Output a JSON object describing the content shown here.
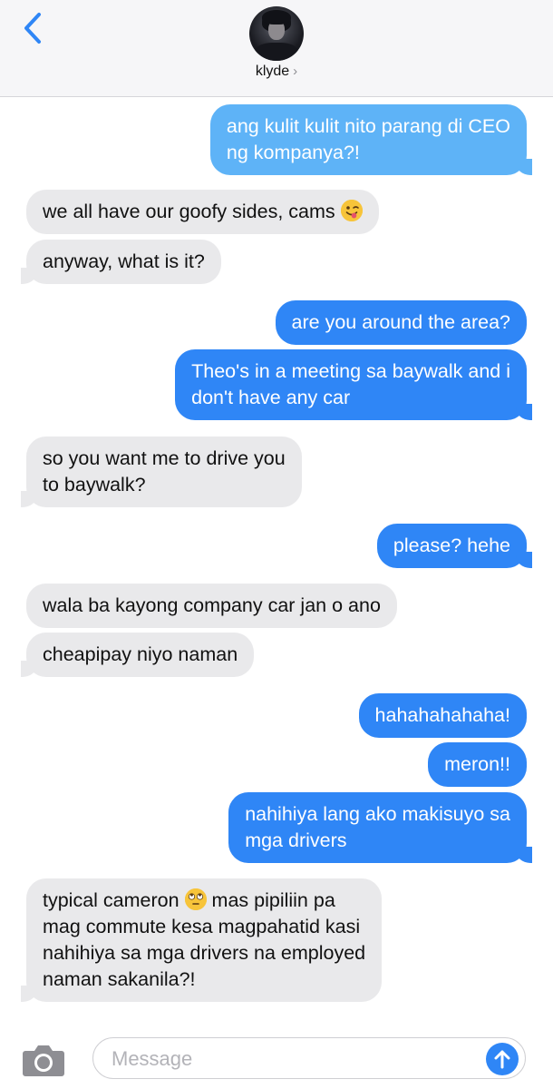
{
  "header": {
    "back_icon": "chevron-left-icon",
    "contact_name": "klyde",
    "contact_chevron": "›",
    "accent_color": "#2f86f6"
  },
  "messages": [
    {
      "sender": "me",
      "lines": [
        "ang kulit kulit nito parang di CEO",
        "ng kompanya?!"
      ]
    },
    {
      "sender": "them",
      "lines": [
        "we all have our goofy sides, cams"
      ],
      "emoji": "winking-face-with-tongue"
    },
    {
      "sender": "them",
      "lines": [
        "anyway, what is it?"
      ]
    },
    {
      "sender": "me",
      "lines": [
        "are you around the area?"
      ]
    },
    {
      "sender": "me",
      "lines": [
        "Theo's in a meeting sa baywalk and i",
        "don't have any car"
      ]
    },
    {
      "sender": "them",
      "lines": [
        "so you want me to drive you",
        "to baywalk?"
      ]
    },
    {
      "sender": "me",
      "lines": [
        "please? hehe"
      ]
    },
    {
      "sender": "them",
      "lines": [
        "wala ba kayong company car jan o ano"
      ]
    },
    {
      "sender": "them",
      "lines": [
        "cheapipay niyo naman"
      ]
    },
    {
      "sender": "me",
      "lines": [
        "hahahahahaha!"
      ]
    },
    {
      "sender": "me",
      "lines": [
        "meron!!"
      ]
    },
    {
      "sender": "me",
      "lines": [
        "nahihiya lang ako makisuyo sa",
        "mga drivers"
      ]
    },
    {
      "sender": "them",
      "lines": [
        "typical cameron",
        "mag commute kesa magpahatid kasi",
        "nahihiya sa mga drivers na employed",
        "naman sakanila?!"
      ],
      "inline_after_first": "mas pipiliin pa",
      "emoji": "face-with-rolling-eyes"
    }
  ],
  "composer": {
    "placeholder": "Message",
    "camera_icon": "camera-icon",
    "send_icon": "arrow-up-icon"
  },
  "colors": {
    "outgoing_bubble": "#2f86f6",
    "outgoing_bubble_light": "#5eb3f7",
    "incoming_bubble": "#e9e9eb"
  }
}
